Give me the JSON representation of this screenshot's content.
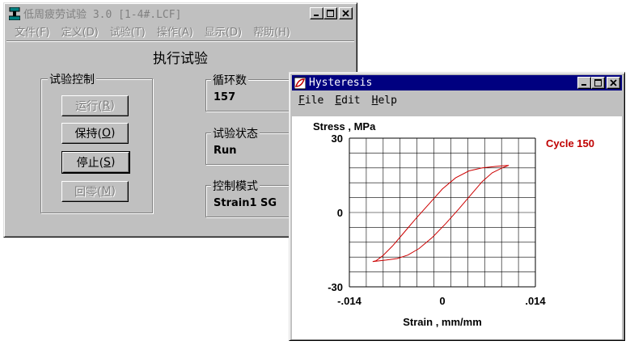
{
  "main_window": {
    "title": "低周疲劳试验 3.0 [1-4#.LCF]",
    "menu": [
      "文件(F)",
      "定义(D)",
      "试验(T)",
      "操作(A)",
      "显示(D)",
      "帮助(H)"
    ],
    "panel_title": "执行试验",
    "control_group": {
      "label": "试验控制",
      "buttons": [
        {
          "text": "运行(",
          "key": "R",
          "tail": ")",
          "enabled": false
        },
        {
          "text": "保持(",
          "key": "O",
          "tail": ")",
          "enabled": true
        },
        {
          "text": "停止(",
          "key": "S",
          "tail": ")",
          "enabled": true
        },
        {
          "text": "回零(",
          "key": "M",
          "tail": ")",
          "enabled": false
        }
      ]
    },
    "fields": [
      {
        "label": "循环数",
        "value": "157"
      },
      {
        "label": "试验状态",
        "value": "Run"
      },
      {
        "label": "控制模式",
        "value": "Strain1 SG"
      }
    ]
  },
  "hysteresis_window": {
    "title": "Hysteresis",
    "menu": [
      "File",
      "Edit",
      "Help"
    ],
    "menu_keys": [
      "F",
      "E",
      "H"
    ],
    "menu_tails": [
      "ile",
      "dit",
      "elp"
    ]
  },
  "chart_data": {
    "type": "line",
    "ylabel": "Stress , MPa",
    "xlabel": "Strain , mm/mm",
    "annotation": "Cycle 150",
    "annotation_color": "#c00000",
    "line_color": "#cc0000",
    "xlim": [
      -0.014,
      0.014
    ],
    "ylim": [
      -30,
      30
    ],
    "x_ticks": [
      -0.014,
      0,
      0.014
    ],
    "x_tick_labels": [
      "-.014",
      "0",
      ".014"
    ],
    "y_ticks": [
      30,
      0,
      -30
    ],
    "y_tick_labels": [
      "30",
      "0",
      "-30"
    ],
    "grid": true,
    "grid_divisions_x": 11,
    "grid_divisions_y": 10,
    "series": [
      {
        "x": [
          -0.0105,
          -0.0085,
          -0.0068,
          -0.0052,
          -0.0035,
          -0.0015,
          0.0005,
          0.0025,
          0.0045,
          0.006,
          0.0075,
          0.009,
          0.0098,
          0.01,
          0.0094,
          0.008,
          0.006,
          0.004,
          0.002,
          0.0,
          -0.002,
          -0.004,
          -0.006,
          -0.0075,
          -0.009,
          -0.01,
          -0.0105
        ],
        "y": [
          -19.8,
          -19.2,
          -18.6,
          -17.2,
          -14.5,
          -10.0,
          -4.5,
          1.5,
          7.8,
          12.5,
          16.0,
          18.0,
          18.8,
          19.0,
          18.9,
          18.6,
          18.0,
          16.8,
          14.0,
          9.5,
          3.5,
          -2.5,
          -8.8,
          -13.5,
          -17.5,
          -19.5,
          -19.8
        ]
      }
    ]
  }
}
